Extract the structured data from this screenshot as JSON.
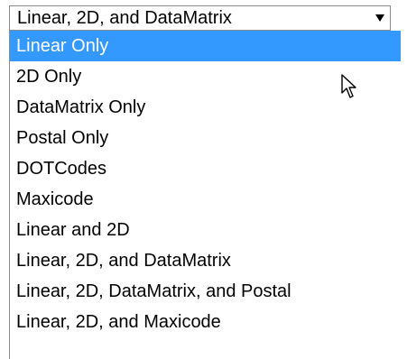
{
  "select": {
    "current_value": "Linear, 2D, and DataMatrix",
    "arrow_icon": "triangle-down-icon"
  },
  "dropdown": {
    "options": [
      {
        "label": "Linear Only",
        "highlighted": true
      },
      {
        "label": "2D Only",
        "highlighted": false
      },
      {
        "label": "DataMatrix Only",
        "highlighted": false
      },
      {
        "label": "Postal Only",
        "highlighted": false
      },
      {
        "label": "DOTCodes",
        "highlighted": false
      },
      {
        "label": "Maxicode",
        "highlighted": false
      },
      {
        "label": "Linear and 2D",
        "highlighted": false
      },
      {
        "label": "Linear, 2D, and DataMatrix",
        "highlighted": false
      },
      {
        "label": "Linear, 2D, DataMatrix, and Postal",
        "highlighted": false
      },
      {
        "label": "Linear, 2D, and Maxicode",
        "highlighted": false
      }
    ]
  },
  "colors": {
    "highlight": "#3399ff",
    "highlight_text": "#ffffff",
    "border": "#8a8a8a"
  },
  "cursor": {
    "icon": "mouse-pointer-icon"
  }
}
